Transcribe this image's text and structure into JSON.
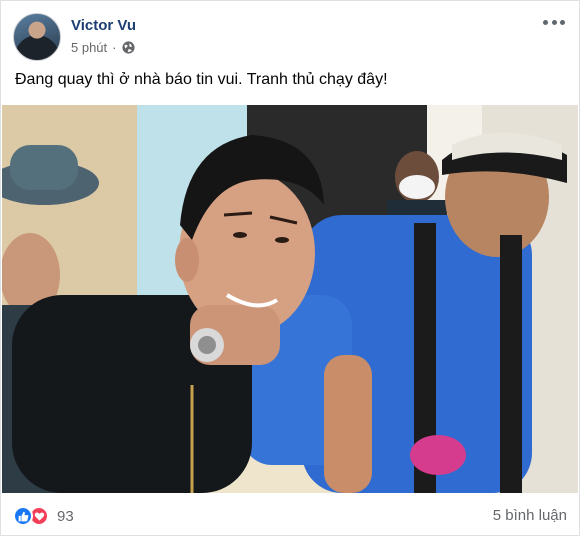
{
  "post": {
    "author": "Victor Vu",
    "time": "5 phút",
    "separator": "·",
    "privacy_icon": "globe-icon",
    "more_icon": "more-options-icon",
    "text": "Đang quay thì ở nhà báo tin vui. Tranh thủ chạy đây!",
    "photo_description": "photo-of-smiling-man-with-headphones"
  },
  "engagement": {
    "reaction_icons": [
      "like-icon",
      "love-icon"
    ],
    "reaction_count": "93",
    "comments_label": "5 bình luận"
  },
  "colors": {
    "author_name": "#1e3e72",
    "secondary_text": "#65676b",
    "like_blue": "#1877f2",
    "love_red": "#f33e58"
  }
}
